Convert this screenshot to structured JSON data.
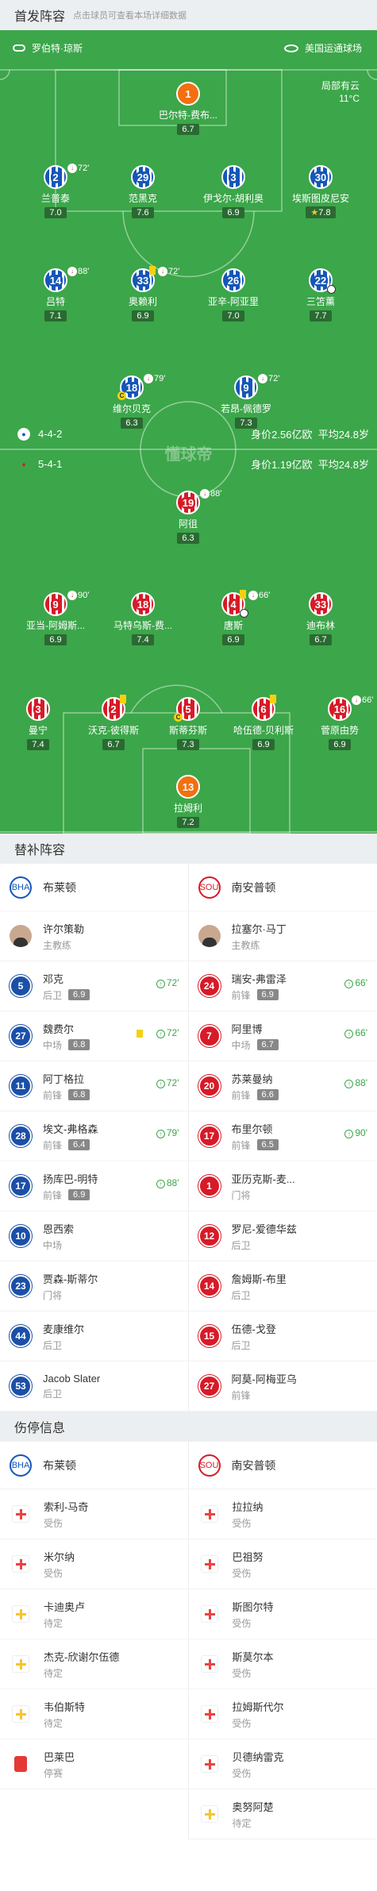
{
  "header": {
    "title": "首发阵容",
    "subtitle": "点击球员可查看本场详细数据"
  },
  "pitch": {
    "referee": "罗伯特·琼斯",
    "stadium": "美国运通球场",
    "weather": "局部有云",
    "temp": "11°C",
    "watermark": "懂球帝"
  },
  "home": {
    "formation": "4-4-2",
    "value": "身价2.56亿欧",
    "age": "平均24.8岁"
  },
  "away": {
    "formation": "5-4-1",
    "value": "身价1.19亿欧",
    "age": "平均24.8岁"
  },
  "players": [
    {
      "id": "p1",
      "num": "1",
      "name": "巴尔特-费布...",
      "rating": "6.7"
    },
    {
      "id": "p2",
      "num": "2",
      "name": "兰普泰",
      "rating": "7.0",
      "sub": "72'"
    },
    {
      "id": "p3",
      "num": "29",
      "name": "范黑克",
      "rating": "7.6"
    },
    {
      "id": "p4",
      "num": "3",
      "name": "伊戈尔-胡利奥",
      "rating": "6.9"
    },
    {
      "id": "p5",
      "num": "30",
      "name": "埃斯图皮尼安",
      "rating": "7.8"
    },
    {
      "id": "p6",
      "num": "14",
      "name": "吕特",
      "rating": "7.1",
      "sub": "88'"
    },
    {
      "id": "p7",
      "num": "33",
      "name": "奥赖利",
      "rating": "6.9",
      "sub": "72'"
    },
    {
      "id": "p8",
      "num": "26",
      "name": "亚辛-阿亚里",
      "rating": "7.0"
    },
    {
      "id": "p9",
      "num": "22",
      "name": "三笘薰",
      "rating": "7.7"
    },
    {
      "id": "p10",
      "num": "18",
      "name": "维尔贝克",
      "rating": "6.3",
      "sub": "79'"
    },
    {
      "id": "p11",
      "num": "9",
      "name": "若昂-佩德罗",
      "rating": "7.3",
      "sub": "72'"
    },
    {
      "id": "q1",
      "num": "19",
      "name": "阿徂",
      "rating": "6.3",
      "sub": "88'"
    },
    {
      "id": "q2",
      "num": "9",
      "name": "亚当-阿姆斯...",
      "rating": "6.9",
      "sub": "90'"
    },
    {
      "id": "q3",
      "num": "18",
      "name": "马特乌斯-费...",
      "rating": "7.4"
    },
    {
      "id": "q4",
      "num": "4",
      "name": "唐斯",
      "rating": "6.9",
      "sub": "66'"
    },
    {
      "id": "q5",
      "num": "33",
      "name": "迪布林",
      "rating": "6.7"
    },
    {
      "id": "q6",
      "num": "3",
      "name": "曼宁",
      "rating": "7.4"
    },
    {
      "id": "q7",
      "num": "2",
      "name": "沃克-彼得斯",
      "rating": "6.7"
    },
    {
      "id": "q8",
      "num": "5",
      "name": "斯蒂芬斯",
      "rating": "7.3"
    },
    {
      "id": "q9",
      "num": "6",
      "name": "哈伍德-贝利斯",
      "rating": "6.9"
    },
    {
      "id": "q10",
      "num": "16",
      "name": "菅原由势",
      "rating": "6.9",
      "sub": "66'"
    },
    {
      "id": "q11",
      "num": "13",
      "name": "拉姆利",
      "rating": "7.2"
    }
  ],
  "subs": {
    "title": "替补阵容",
    "home_team": "布莱顿",
    "away_team": "南安普顿",
    "home_coach": {
      "name": "许尔策勒",
      "role": "主教练"
    },
    "away_coach": {
      "name": "拉塞尔·马丁",
      "role": "主教练"
    },
    "home": [
      {
        "num": "5",
        "name": "邓克",
        "pos": "后卫",
        "rating": "6.9",
        "min": "72'"
      },
      {
        "num": "27",
        "name": "魏费尔",
        "pos": "中场",
        "rating": "6.8",
        "min": "72'"
      },
      {
        "num": "11",
        "name": "阿丁格拉",
        "pos": "前锋",
        "rating": "6.8",
        "min": "72'"
      },
      {
        "num": "28",
        "name": "埃文-弗格森",
        "pos": "前锋",
        "rating": "6.4",
        "min": "79'"
      },
      {
        "num": "17",
        "name": "扬库巴-明特",
        "pos": "前锋",
        "rating": "6.9",
        "min": "88'"
      },
      {
        "num": "10",
        "name": "恩西索",
        "pos": "中场"
      },
      {
        "num": "23",
        "name": "贾森-斯蒂尔",
        "pos": "门将"
      },
      {
        "num": "44",
        "name": "麦康维尔",
        "pos": "后卫"
      },
      {
        "num": "53",
        "name": "Jacob Slater",
        "pos": "后卫"
      }
    ],
    "away": [
      {
        "num": "24",
        "name": "瑞安-弗雷泽",
        "pos": "前锋",
        "rating": "6.9",
        "min": "66'"
      },
      {
        "num": "7",
        "name": "阿里博",
        "pos": "中场",
        "rating": "6.7",
        "min": "66'"
      },
      {
        "num": "20",
        "name": "苏莱曼纳",
        "pos": "前锋",
        "rating": "6.6",
        "min": "88'"
      },
      {
        "num": "17",
        "name": "布里尔顿",
        "pos": "前锋",
        "rating": "6.5",
        "min": "90'"
      },
      {
        "num": "1",
        "name": "亚历克斯-麦...",
        "pos": "门将"
      },
      {
        "num": "12",
        "name": "罗尼-爱德华兹",
        "pos": "后卫"
      },
      {
        "num": "14",
        "name": "詹姆斯-布里",
        "pos": "后卫"
      },
      {
        "num": "15",
        "name": "伍德-戈登",
        "pos": "后卫"
      },
      {
        "num": "27",
        "name": "阿莫-阿梅亚乌",
        "pos": "前锋"
      }
    ]
  },
  "injuries": {
    "title": "伤停信息",
    "home_team": "布莱顿",
    "away_team": "南安普顿",
    "home": [
      {
        "name": "索利-马奇",
        "status": "受伤",
        "type": "red"
      },
      {
        "name": "米尔纳",
        "status": "受伤",
        "type": "red"
      },
      {
        "name": "卡迪奥卢",
        "status": "待定",
        "type": "yel"
      },
      {
        "name": "杰克-欣谢尔伍德",
        "status": "待定",
        "type": "yel"
      },
      {
        "name": "韦伯斯特",
        "status": "待定",
        "type": "yel"
      },
      {
        "name": "巴莱巴",
        "status": "停赛",
        "type": "card"
      }
    ],
    "away": [
      {
        "name": "拉拉纳",
        "status": "受伤",
        "type": "red"
      },
      {
        "name": "巴祖努",
        "status": "受伤",
        "type": "red"
      },
      {
        "name": "斯图尔特",
        "status": "受伤",
        "type": "red"
      },
      {
        "name": "斯莫尔本",
        "status": "受伤",
        "type": "red"
      },
      {
        "name": "拉姆斯代尔",
        "status": "受伤",
        "type": "red"
      },
      {
        "name": "贝德纳雷克",
        "status": "受伤",
        "type": "red"
      },
      {
        "name": "奥努阿楚",
        "status": "待定",
        "type": "yel"
      }
    ]
  }
}
